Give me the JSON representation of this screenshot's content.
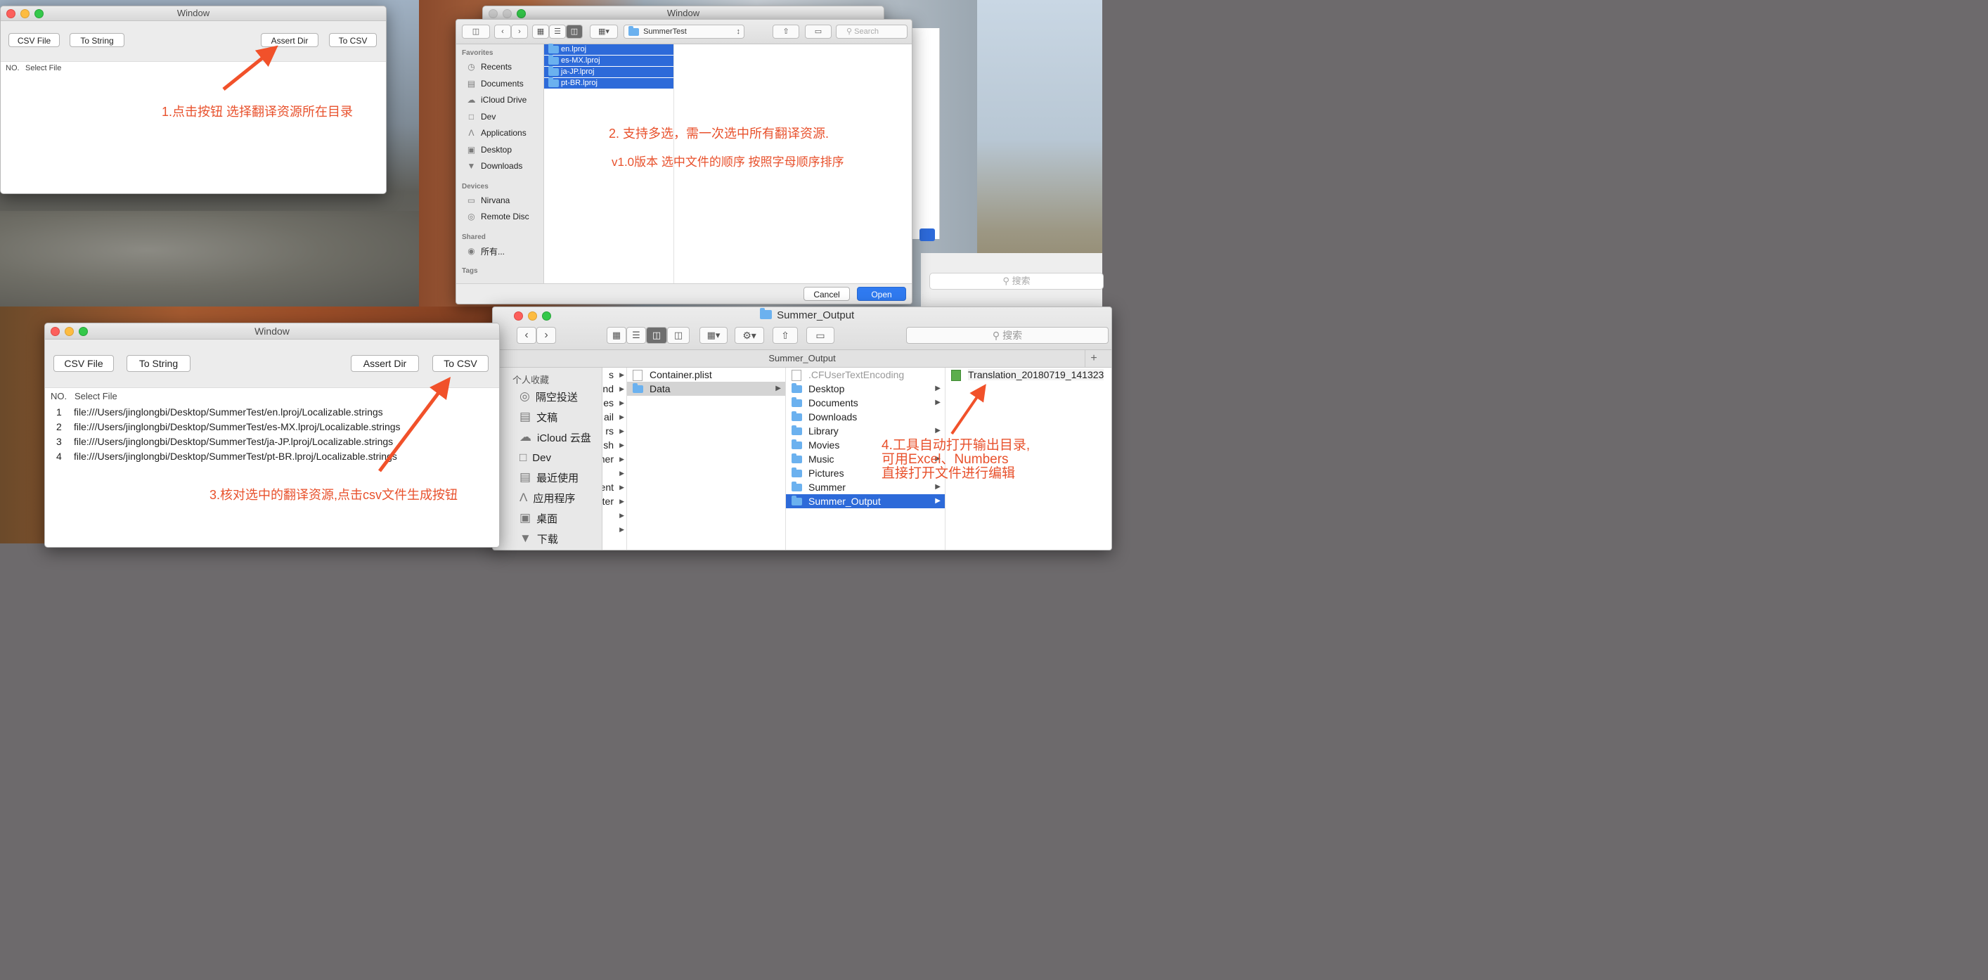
{
  "win1": {
    "title": "Window",
    "buttons": {
      "csv_file": "CSV File",
      "to_string": "To String",
      "assert_dir": "Assert Dir",
      "to_csv": "To CSV"
    },
    "columns": {
      "no": "NO.",
      "select_file": "Select File"
    }
  },
  "annotations": {
    "step1": "1.点击按钮 选择翻译资源所在目录",
    "step2_line1": "2. 支持多选，需一次选中所有翻译资源.",
    "step2_line2": "v1.0版本 选中文件的顺序 按照字母顺序排序",
    "step3": "3.核对选中的翻译资源,点击csv文件生成按钮",
    "step4_line1": "4.工具自动打开输出目录,",
    "step4_line2": "可用Excel、Numbers",
    "step4_line3": "直接打开文件进行编辑",
    "color": "#e8512c"
  },
  "dialog": {
    "back_title": "Window",
    "location": "SummerTest",
    "search_placeholder": "Search",
    "favorites_header": "Favorites",
    "favorites": [
      "Recents",
      "Documents",
      "iCloud Drive",
      "Dev",
      "Applications",
      "Desktop",
      "Downloads"
    ],
    "devices_header": "Devices",
    "devices": [
      "Nirvana",
      "Remote Disc"
    ],
    "shared_header": "Shared",
    "shared": [
      "所有..."
    ],
    "tags_header": "Tags",
    "files": [
      "en.lproj",
      "es-MX.lproj",
      "ja-JP.lproj",
      "pt-BR.lproj"
    ],
    "cancel": "Cancel",
    "open": "Open"
  },
  "right_bg": {
    "search_placeholder": "搜索"
  },
  "win3": {
    "title": "Window",
    "buttons": {
      "csv_file": "CSV File",
      "to_string": "To String",
      "assert_dir": "Assert Dir",
      "to_csv": "To CSV"
    },
    "columns": {
      "no": "NO.",
      "select_file": "Select File"
    },
    "rows": [
      {
        "no": "1",
        "path": "file:///Users/jinglongbi/Desktop/SummerTest/en.lproj/Localizable.strings"
      },
      {
        "no": "2",
        "path": "file:///Users/jinglongbi/Desktop/SummerTest/es-MX.lproj/Localizable.strings"
      },
      {
        "no": "3",
        "path": "file:///Users/jinglongbi/Desktop/SummerTest/ja-JP.lproj/Localizable.strings"
      },
      {
        "no": "4",
        "path": "file:///Users/jinglongbi/Desktop/SummerTest/pt-BR.lproj/Localizable.strings"
      }
    ]
  },
  "finder": {
    "title": "Summer_Output",
    "path_bar": "Summer_Output",
    "search_placeholder": "搜索",
    "sidebar_header": "个人收藏",
    "sidebar": [
      "隔空投送",
      "文稿",
      "iCloud 云盘",
      "Dev",
      "最近使用",
      "应用程序",
      "桌面",
      "下载"
    ],
    "col0_fragments": [
      "s",
      "nd",
      "es",
      "ail",
      "rs",
      "sh",
      "ner",
      "",
      "ent",
      "ter",
      "",
      ""
    ],
    "col1": [
      "Container.plist",
      "Data"
    ],
    "col2": [
      ".CFUserTextEncoding",
      "Desktop",
      "Documents",
      "Downloads",
      "Library",
      "Movies",
      "Music",
      "Pictures",
      "Summer",
      "Summer_Output"
    ],
    "col3": [
      "Translation_20180719_141323"
    ],
    "plus": "+"
  }
}
